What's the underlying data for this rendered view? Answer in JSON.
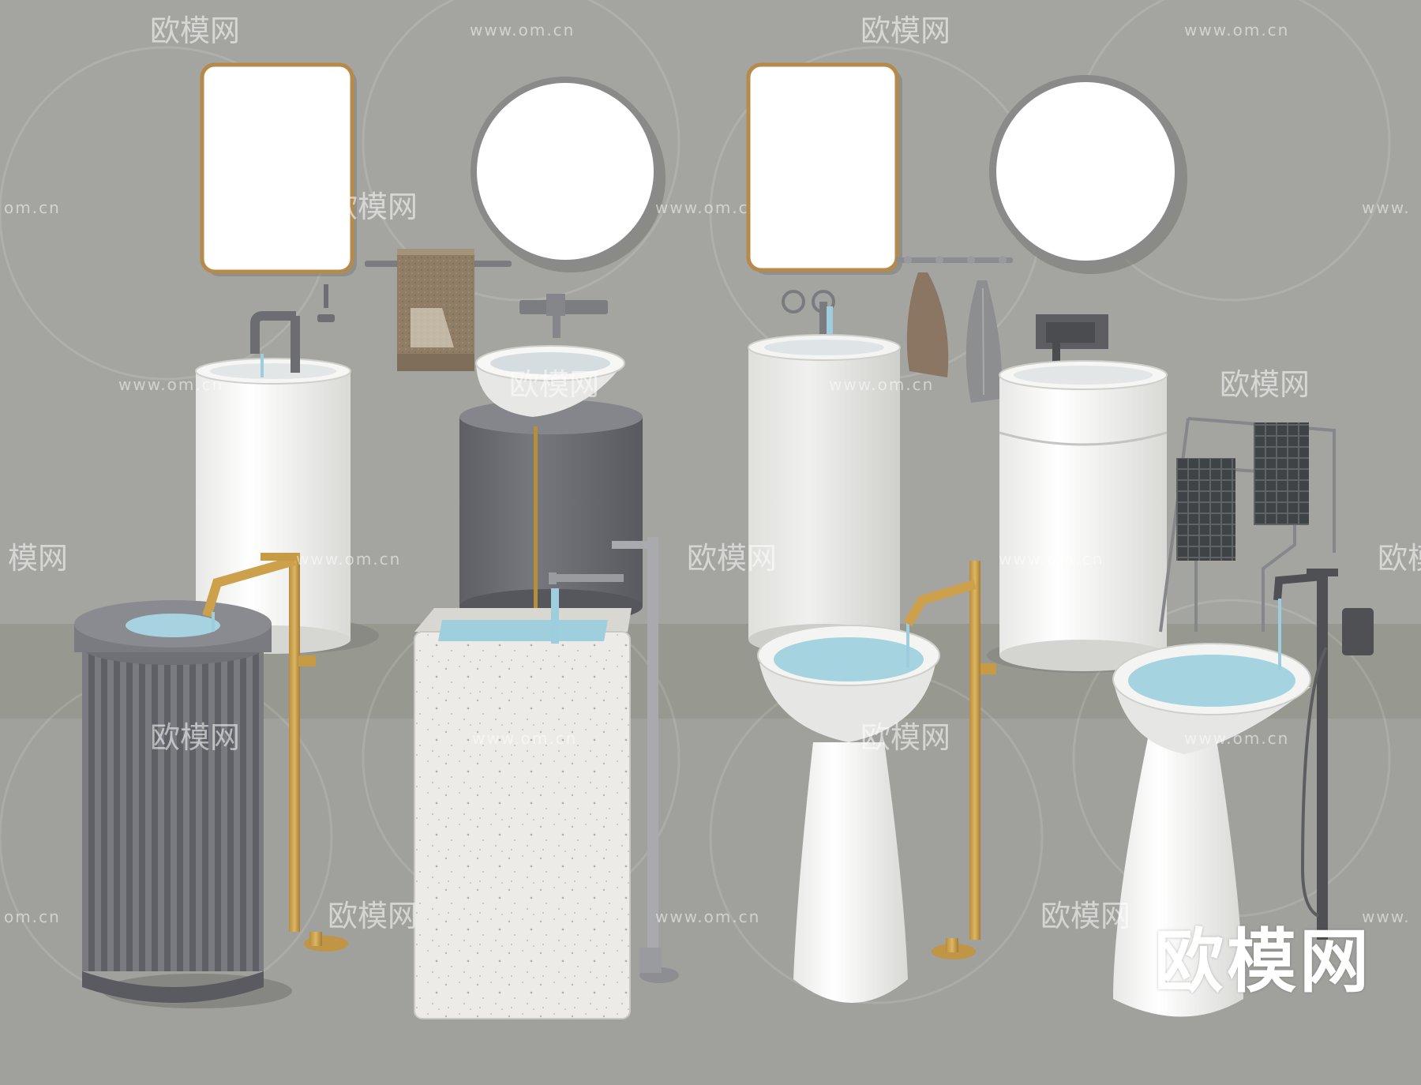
{
  "watermark": {
    "brand": "欧模网",
    "url": "www.om.cn",
    "url_partial_left": "om.cn",
    "url_partial_right": "www.",
    "brand_partial_left": "模网",
    "brand_partial_right": "欧"
  },
  "logo": {
    "text": "欧模网"
  },
  "colors": {
    "wall": "#a4a5a0",
    "floor_band": "#969792",
    "floor": "#8f908b",
    "gold": "#c9a24e",
    "white": "#f4f4f2",
    "dark_gray": "#6d6e73",
    "water": "#b9dbe6"
  }
}
